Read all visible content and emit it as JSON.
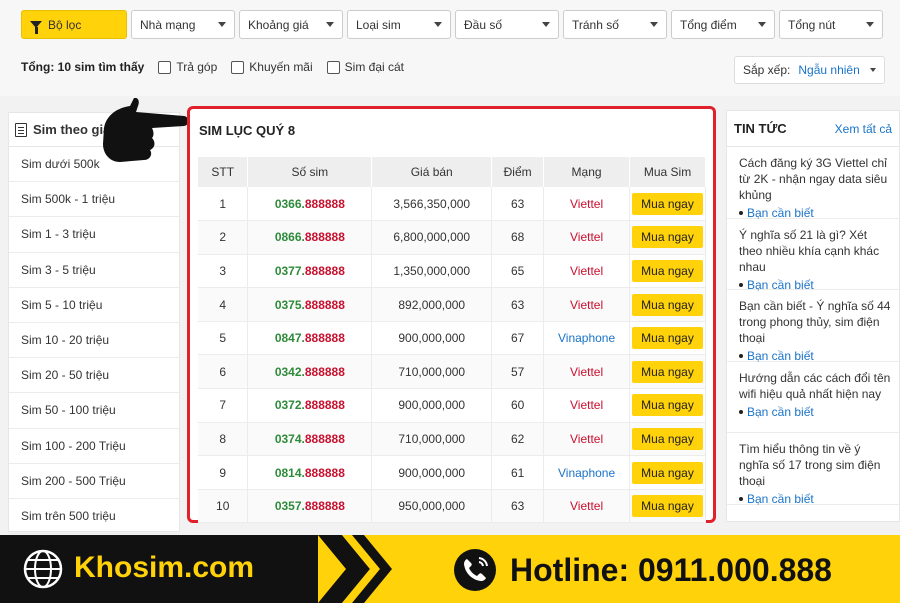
{
  "filters": {
    "primary": "Bộ lọc",
    "dropdowns": [
      "Nhà mạng",
      "Khoảng giá",
      "Loại sim",
      "Đầu số",
      "Tránh số",
      "Tổng điểm",
      "Tổng nút"
    ]
  },
  "summary": {
    "total": "Tổng: 10 sim tìm thấy",
    "options": [
      "Trả góp",
      "Khuyến mãi",
      "Sim đại cát"
    ]
  },
  "sort": {
    "label": "Sắp xếp:",
    "value": "Ngẫu nhiên"
  },
  "sidebar": {
    "title": "Sim theo giá",
    "items": [
      "Sim dưới 500k",
      "Sim 500k - 1 triệu",
      "Sim 1 - 3 triệu",
      "Sim 3 - 5 triệu",
      "Sim 5 - 10 triệu",
      "Sim 10 - 20 triệu",
      "Sim 20 - 50 triệu",
      "Sim 50 - 100 triệu",
      "Sim 100 - 200 Triệu",
      "Sim 200 - 500 Triệu",
      "Sim trên 500 triệu"
    ]
  },
  "main": {
    "title": "SIM LỤC QUÝ 8",
    "columns": [
      "STT",
      "Số sim",
      "Giá bán",
      "Điểm",
      "Mạng",
      "Mua Sim"
    ],
    "buy_label": "Mua ngay",
    "rows": [
      {
        "stt": "1",
        "prefix": "0366.",
        "suffix": "888888",
        "price": "3,566,350,000",
        "score": "63",
        "network": "Viettel"
      },
      {
        "stt": "2",
        "prefix": "0866.",
        "suffix": "888888",
        "price": "6,800,000,000",
        "score": "68",
        "network": "Viettel"
      },
      {
        "stt": "3",
        "prefix": "0377.",
        "suffix": "888888",
        "price": "1,350,000,000",
        "score": "65",
        "network": "Viettel"
      },
      {
        "stt": "4",
        "prefix": "0375.",
        "suffix": "888888",
        "price": "892,000,000",
        "score": "63",
        "network": "Viettel"
      },
      {
        "stt": "5",
        "prefix": "0847.",
        "suffix": "888888",
        "price": "900,000,000",
        "score": "67",
        "network": "Vinaphone"
      },
      {
        "stt": "6",
        "prefix": "0342.",
        "suffix": "888888",
        "price": "710,000,000",
        "score": "57",
        "network": "Viettel"
      },
      {
        "stt": "7",
        "prefix": "0372.",
        "suffix": "888888",
        "price": "900,000,000",
        "score": "60",
        "network": "Viettel"
      },
      {
        "stt": "8",
        "prefix": "0374.",
        "suffix": "888888",
        "price": "710,000,000",
        "score": "62",
        "network": "Viettel"
      },
      {
        "stt": "9",
        "prefix": "0814.",
        "suffix": "888888",
        "price": "900,000,000",
        "score": "61",
        "network": "Vinaphone"
      },
      {
        "stt": "10",
        "prefix": "0357.",
        "suffix": "888888",
        "price": "950,000,000",
        "score": "63",
        "network": "Viettel"
      }
    ]
  },
  "news": {
    "title": "TIN TỨC",
    "see_all": "Xem tất cả",
    "items": [
      {
        "text": "Cách đăng ký 3G Viettel chỉ từ 2K - nhận ngay data siêu khủng",
        "meta": "Bạn cần biết"
      },
      {
        "text": "Ý nghĩa số 21 là gì? Xét theo nhiều khía cạnh khác nhau",
        "meta": "Bạn cần biết"
      },
      {
        "text": "Bạn cần biết - Ý nghĩa số 44 trong phong thủy, sim điện thoại",
        "meta": "Bạn cần biết"
      },
      {
        "text": "Hướng dẫn các cách đổi tên wifi hiệu quả nhất hiện nay",
        "meta": "Bạn cần biết"
      },
      {
        "text": "Tìm hiểu thông tin về ý nghĩa số 17 trong sim điện thoại",
        "meta": "Bạn cần biết"
      }
    ]
  },
  "footer": {
    "brand": "Khosim.com",
    "hotline": "Hotline: 0911.000.888"
  },
  "colors": {
    "accent": "#ffd20a",
    "red": "#c8102e",
    "green": "#2e8b3a",
    "blue": "#1a73c8"
  }
}
